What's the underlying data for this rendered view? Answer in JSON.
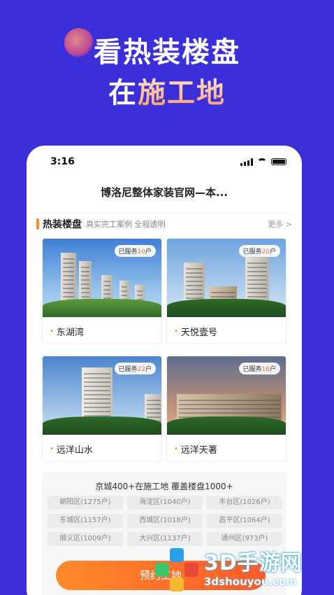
{
  "promo": {
    "line1": "看热装楼盘",
    "line2_prefix": "在",
    "line2_accent": "施工地"
  },
  "status_bar": {
    "time": "3:16"
  },
  "page": {
    "title": "博洛尼整体家装官网—本..."
  },
  "section": {
    "title": "热装楼盘",
    "subtitle": "真实完工案例 全程透明",
    "more_label": "更多 >"
  },
  "projects": [
    {
      "name": "东湖湾",
      "badge_prefix": "已服务",
      "badge_count": "10",
      "badge_unit": "户"
    },
    {
      "name": "天悦壹号",
      "badge_prefix": "已服务",
      "badge_count": "20",
      "badge_unit": "户"
    },
    {
      "name": "远洋山水",
      "badge_prefix": "已服务",
      "badge_count": "22",
      "badge_unit": "户"
    },
    {
      "name": "远洋天著",
      "badge_prefix": "已服务",
      "badge_count": "16",
      "badge_unit": "户"
    }
  ],
  "summary": {
    "title": "京城400+在施工地  覆盖楼盘1000+",
    "districts": [
      "朝阳区(1275户)",
      "海淀区(1040户)",
      "丰台区(1026户)",
      "东城区(1157户)",
      "西城区(1018户)",
      "昌平区(1064户)",
      "顺义区(1009户)",
      "大兴区(1137户)",
      "通州区(973户)"
    ]
  },
  "cta": {
    "label": "预约工地"
  },
  "watermark": {
    "name": "3D手游网",
    "url": "3dshouyou.com"
  },
  "colors": {
    "background": "#3a2fd8",
    "accent": "#ff8a1f",
    "cta": "#ff6a2a"
  }
}
